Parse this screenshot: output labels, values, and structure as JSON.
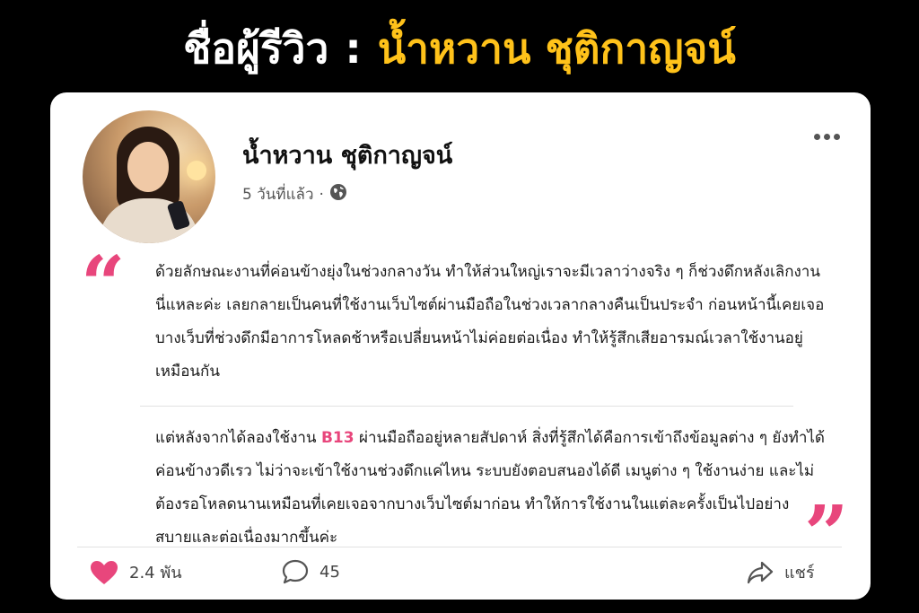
{
  "headline": {
    "label": "ชื่อผู้รีวิว",
    "separator": ":",
    "name": "น้ำหวาน ชุติกาญจน์",
    "name_color": "#ffc21a"
  },
  "post": {
    "author": "น้ำหวาน ชุติกาญจน์",
    "time": "5 วันที่แล้ว",
    "time_separator": "·",
    "visibility_icon": "globe-icon",
    "more_icon": "more-horizontal-icon",
    "quote_open": "“",
    "quote_close": "”",
    "quote_color": "#e8467c",
    "paragraph1": "ด้วยลักษณะงานที่ค่อนข้างยุ่งในช่วงกลางวัน ทำให้ส่วนใหญ่เราจะมีเวลาว่างจริง ๆ ก็ช่วงดึกหลังเลิกงานนี่แหละค่ะ เลยกลายเป็นคนที่ใช้งานเว็บไซต์ผ่านมือถือในช่วงเวลากลางคืนเป็นประจำ ก่อนหน้านี้เคยเจอบางเว็บที่ช่วงดึกมีอาการโหลดช้าหรือเปลี่ยนหน้าไม่ค่อยต่อเนื่อง ทำให้รู้สึกเสียอารมณ์เวลาใช้งานอยู่เหมือนกัน",
    "paragraph2_before": "แต่หลังจากได้ลองใช้งาน ",
    "paragraph2_highlight": "B13",
    "paragraph2_after": " ผ่านมือถืออยู่หลายสัปดาห์ สิ่งที่รู้สึกได้คือการเข้าถึงข้อมูลต่าง ๆ ยังทำได้ค่อนข้างวดีเรว ไม่ว่าจะเข้าใช้งานช่วงดึกแค่ไหน ระบบยังตอบสนองได้ดี เมนูต่าง ๆ ใช้งานง่าย และไม่ต้องรอโหลดนานเหมือนที่เคยเจอจากบางเว็บไซต์มาก่อน ทำให้การใช้งานในแต่ละครั้งเป็นไปอย่างสบายและต่อเนื่องมากขึ้นค่ะ",
    "highlight_color": "#e8467c"
  },
  "actions": {
    "likes": "2.4 พัน",
    "like_icon": "heart-icon",
    "like_color": "#e8467c",
    "comments": "45",
    "comment_icon": "comment-icon",
    "share_label": "แชร์",
    "share_icon": "share-icon"
  }
}
